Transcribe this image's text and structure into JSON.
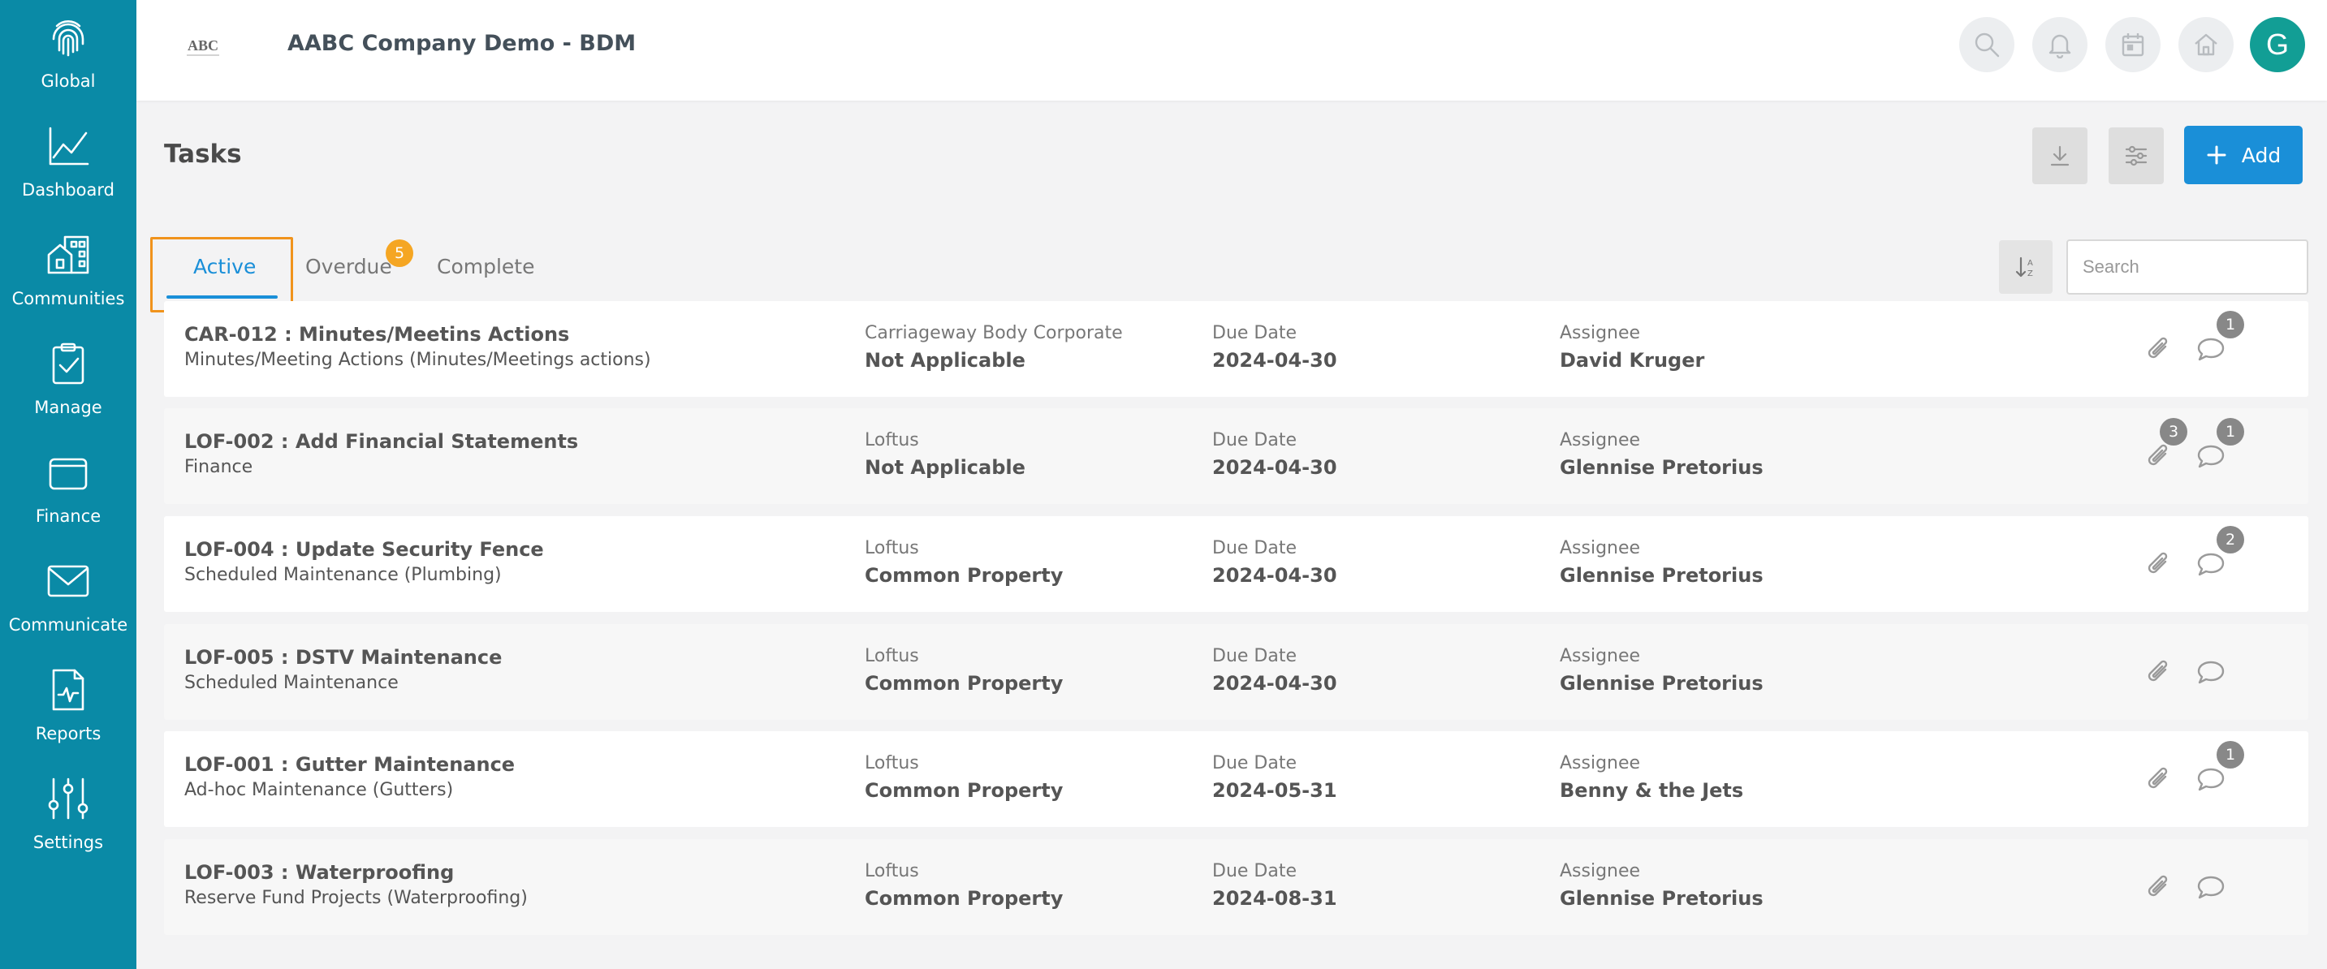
{
  "sidebar": {
    "items": [
      {
        "label": "Global",
        "icon": "fingerprint-icon"
      },
      {
        "label": "Dashboard",
        "icon": "line-chart-icon"
      },
      {
        "label": "Communities",
        "icon": "buildings-icon"
      },
      {
        "label": "Manage",
        "icon": "clipboard-check-icon"
      },
      {
        "label": "Finance",
        "icon": "wallet-icon"
      },
      {
        "label": "Communicate",
        "icon": "envelope-icon"
      },
      {
        "label": "Reports",
        "icon": "report-icon"
      },
      {
        "label": "Settings",
        "icon": "sliders-icon"
      }
    ]
  },
  "header": {
    "logo_text": "ABC",
    "company_name": "AABC Company Demo - BDM",
    "avatar_initial": "G",
    "icons": [
      "search-icon",
      "bell-icon",
      "calendar-icon",
      "home-icon"
    ]
  },
  "page": {
    "title": "Tasks",
    "add_label": "Add"
  },
  "tabs": {
    "active": "Active",
    "overdue": "Overdue",
    "overdue_count": "5",
    "complete": "Complete"
  },
  "search": {
    "placeholder": "Search",
    "value": ""
  },
  "colors": {
    "sidebar": "#0a8aa6",
    "accent": "#1a8fd8",
    "badge": "#f5a623",
    "avatar": "#129e95",
    "highlight": "#f0931c"
  },
  "tasks": [
    {
      "code_title": "CAR-012 : Minutes/Meetins Actions",
      "category": "Minutes/Meeting Actions (Minutes/Meetings actions)",
      "community": "Carriageway Body Corporate",
      "area": "Not Applicable",
      "due_label": "Due Date",
      "due_date": "2024-04-30",
      "assignee_label": "Assignee",
      "assignee": "David Kruger",
      "attachments": "",
      "comments": "1"
    },
    {
      "code_title": "LOF-002 : Add Financial Statements",
      "category": "Finance",
      "community": "Loftus",
      "area": "Not Applicable",
      "due_label": "Due Date",
      "due_date": "2024-04-30",
      "assignee_label": "Assignee",
      "assignee": "Glennise Pretorius",
      "attachments": "3",
      "comments": "1"
    },
    {
      "code_title": "LOF-004 : Update Security Fence",
      "category": "Scheduled Maintenance (Plumbing)",
      "community": "Loftus",
      "area": "Common Property",
      "due_label": "Due Date",
      "due_date": "2024-04-30",
      "assignee_label": "Assignee",
      "assignee": "Glennise Pretorius",
      "attachments": "",
      "comments": "2"
    },
    {
      "code_title": "LOF-005 : DSTV Maintenance",
      "category": "Scheduled Maintenance",
      "community": "Loftus",
      "area": "Common Property",
      "due_label": "Due Date",
      "due_date": "2024-04-30",
      "assignee_label": "Assignee",
      "assignee": "Glennise Pretorius",
      "attachments": "",
      "comments": ""
    },
    {
      "code_title": "LOF-001 : Gutter Maintenance",
      "category": "Ad-hoc Maintenance (Gutters)",
      "community": "Loftus",
      "area": "Common Property",
      "due_label": "Due Date",
      "due_date": "2024-05-31",
      "assignee_label": "Assignee",
      "assignee": "Benny & the Jets",
      "attachments": "",
      "comments": "1"
    },
    {
      "code_title": "LOF-003 : Waterproofing",
      "category": "Reserve Fund Projects (Waterproofing)",
      "community": "Loftus",
      "area": "Common Property",
      "due_label": "Due Date",
      "due_date": "2024-08-31",
      "assignee_label": "Assignee",
      "assignee": "Glennise Pretorius",
      "attachments": "",
      "comments": ""
    }
  ]
}
